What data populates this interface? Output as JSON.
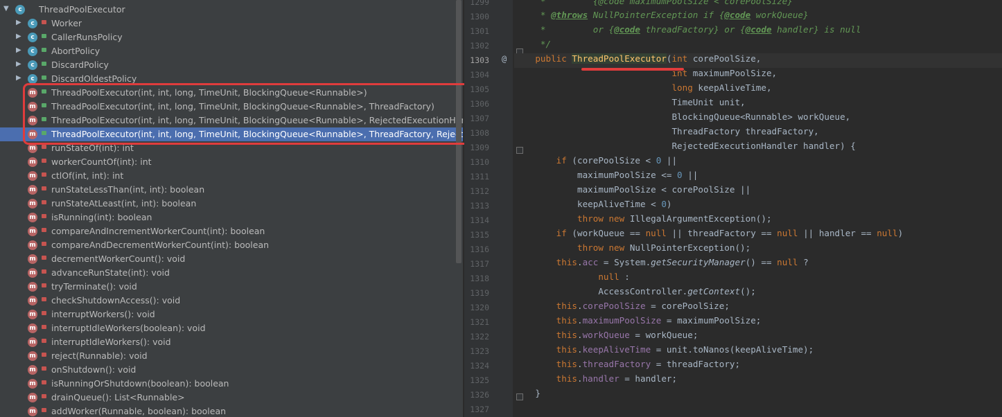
{
  "structure": {
    "root": {
      "label": "ThreadPoolExecutor"
    },
    "classes": [
      {
        "label": "Worker"
      },
      {
        "label": "CallerRunsPolicy"
      },
      {
        "label": "AbortPolicy"
      },
      {
        "label": "DiscardPolicy"
      },
      {
        "label": "DiscardOldestPolicy"
      }
    ],
    "constructors": [
      {
        "label": "ThreadPoolExecutor(int, int, long, TimeUnit, BlockingQueue<Runnable>)"
      },
      {
        "label": "ThreadPoolExecutor(int, int, long, TimeUnit, BlockingQueue<Runnable>, ThreadFactory)"
      },
      {
        "label": "ThreadPoolExecutor(int, int, long, TimeUnit, BlockingQueue<Runnable>, RejectedExecutionHandler)"
      },
      {
        "label": "ThreadPoolExecutor(int, int, long, TimeUnit, BlockingQueue<Runnable>, ThreadFactory, RejectedExecutionHandler)"
      }
    ],
    "methods": [
      {
        "label": "runStateOf(int): int"
      },
      {
        "label": "workerCountOf(int): int"
      },
      {
        "label": "ctlOf(int, int): int"
      },
      {
        "label": "runStateLessThan(int, int): boolean"
      },
      {
        "label": "runStateAtLeast(int, int): boolean"
      },
      {
        "label": "isRunning(int): boolean"
      },
      {
        "label": "compareAndIncrementWorkerCount(int): boolean"
      },
      {
        "label": "compareAndDecrementWorkerCount(int): boolean"
      },
      {
        "label": "decrementWorkerCount(): void"
      },
      {
        "label": "advanceRunState(int): void"
      },
      {
        "label": "tryTerminate(): void"
      },
      {
        "label": "checkShutdownAccess(): void"
      },
      {
        "label": "interruptWorkers(): void"
      },
      {
        "label": "interruptIdleWorkers(boolean): void"
      },
      {
        "label": "interruptIdleWorkers(): void"
      },
      {
        "label": "reject(Runnable): void"
      },
      {
        "label": "onShutdown(): void"
      },
      {
        "label": "isRunningOrShutdown(boolean): boolean"
      },
      {
        "label": "drainQueue(): List<Runnable>"
      },
      {
        "label": "addWorker(Runnable, boolean): boolean"
      }
    ]
  },
  "editor": {
    "line_numbers": [
      "1299",
      "1300",
      "1301",
      "1302",
      "1303",
      "1304",
      "1305",
      "1306",
      "1307",
      "1308",
      "1309",
      "1310",
      "1311",
      "1312",
      "1313",
      "1314",
      "1315",
      "1316",
      "1317",
      "1318",
      "1319",
      "1320",
      "1321",
      "1322",
      "1323",
      "1324",
      "1325",
      "1326",
      "1327"
    ],
    "gutter_annotation": "@",
    "code": {
      "l1299": "     *         {@code maximumPoolSize < corePoolSize}",
      "l1300a": "     * ",
      "l1300b": "@throws",
      "l1300c": " NullPointerException if {",
      "l1300d": "@code",
      "l1300e": " workQueue}",
      "l1301a": "     *         or {",
      "l1301b": "@code",
      "l1301c": " threadFactory} or {",
      "l1301d": "@code",
      "l1301e": " handler} is null",
      "l1302": "     */",
      "l1303a": "    public ",
      "l1303b": "ThreadPoolExecutor",
      "l1303c": "(",
      "l1303d": "int",
      "l1303e": " corePoolSize,",
      "l1304a": "                              ",
      "l1304b": "int",
      "l1304c": " maximumPoolSize,",
      "l1305a": "                              ",
      "l1305b": "long",
      "l1305c": " keepAliveTime,",
      "l1306": "                              TimeUnit unit,",
      "l1307": "                              BlockingQueue<Runnable> workQueue,",
      "l1308": "                              ThreadFactory threadFactory,",
      "l1309": "                              RejectedExecutionHandler handler) {",
      "l1310a": "        if",
      "l1310b": " (corePoolSize < ",
      "l1310c": "0",
      "l1310d": " ||",
      "l1311a": "            maximumPoolSize <= ",
      "l1311b": "0",
      "l1311c": " ||",
      "l1312": "            maximumPoolSize < corePoolSize ||",
      "l1313a": "            keepAliveTime < ",
      "l1313b": "0",
      "l1313c": ")",
      "l1314a": "            throw new",
      "l1314b": " IllegalArgumentException();",
      "l1315a": "        if",
      "l1315b": " (workQueue == ",
      "l1315c": "null",
      "l1315d": " || threadFactory == ",
      "l1315e": "null",
      "l1315f": " || handler == ",
      "l1315g": "null",
      "l1315h": ")",
      "l1316a": "            throw new",
      "l1316b": " NullPointerException();",
      "l1317a": "        this",
      "l1317b": ".",
      "l1317c": "acc",
      "l1317d": " = System.",
      "l1317e": "getSecurityManager",
      "l1317f": "() == ",
      "l1317g": "null",
      "l1317h": " ?",
      "l1318a": "                ",
      "l1318b": "null",
      "l1318c": " :",
      "l1319a": "                AccessController.",
      "l1319b": "getContext",
      "l1319c": "();",
      "l1320a": "        this",
      "l1320b": ".",
      "l1320c": "corePoolSize",
      "l1320d": " = corePoolSize;",
      "l1321a": "        this",
      "l1321b": ".",
      "l1321c": "maximumPoolSize",
      "l1321d": " = maximumPoolSize;",
      "l1322a": "        this",
      "l1322b": ".",
      "l1322c": "workQueue",
      "l1322d": " = workQueue;",
      "l1323a": "        this",
      "l1323b": ".",
      "l1323c": "keepAliveTime",
      "l1323d": " = unit.toNanos(keepAliveTime);",
      "l1324a": "        this",
      "l1324b": ".",
      "l1324c": "threadFactory",
      "l1324d": " = threadFactory;",
      "l1325a": "        this",
      "l1325b": ".",
      "l1325c": "handler",
      "l1325d": " = handler;",
      "l1326": "    }"
    }
  },
  "colors": {
    "background": "#2b2b2b",
    "structure_bg": "#3c3f41",
    "selection": "#4b6eaf",
    "annotation_red": "#e03c3c",
    "keyword": "#cc7832",
    "comment": "#629755"
  }
}
